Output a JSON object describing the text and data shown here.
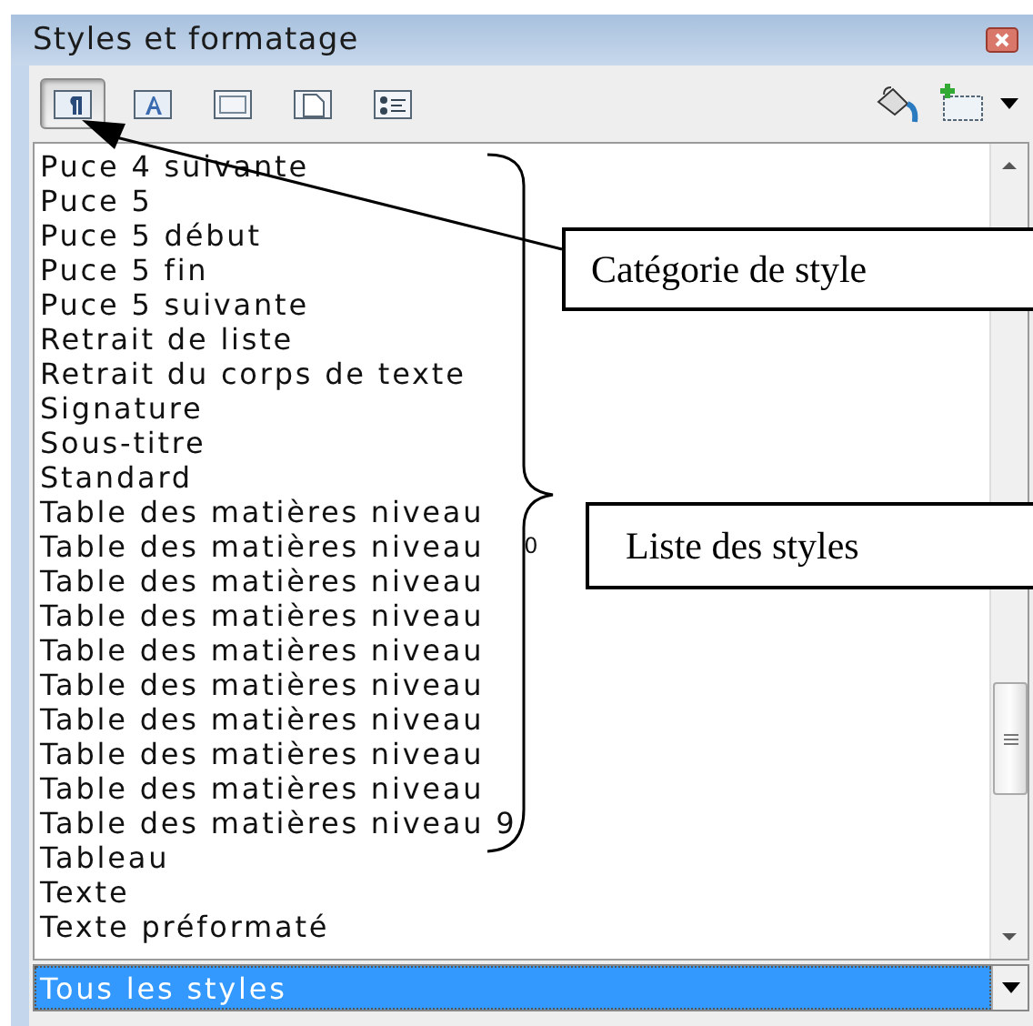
{
  "window": {
    "title": "Styles et formatage"
  },
  "categories": [
    {
      "kind": "paragraph",
      "selected": true
    },
    {
      "kind": "character",
      "selected": false
    },
    {
      "kind": "frame",
      "selected": false
    },
    {
      "kind": "page",
      "selected": false
    },
    {
      "kind": "list",
      "selected": false
    }
  ],
  "styles": [
    {
      "label": "Puce 4 suivante"
    },
    {
      "label": "Puce 5"
    },
    {
      "label": "Puce 5 début"
    },
    {
      "label": "Puce 5 fin"
    },
    {
      "label": "Puce 5 suivante"
    },
    {
      "label": "Retrait de liste"
    },
    {
      "label": "Retrait du corps de texte"
    },
    {
      "label": "Signature"
    },
    {
      "label": "Sous-titre"
    },
    {
      "label": "Standard"
    },
    {
      "label": "Table des matières niveau"
    },
    {
      "label": "Table des matières niveau",
      "suffix": "0"
    },
    {
      "label": "Table des matières niveau"
    },
    {
      "label": "Table des matières niveau"
    },
    {
      "label": "Table des matières niveau"
    },
    {
      "label": "Table des matières niveau"
    },
    {
      "label": "Table des matières niveau"
    },
    {
      "label": "Table des matières niveau"
    },
    {
      "label": "Table des matières niveau"
    },
    {
      "label": "Table des matières niveau 9"
    },
    {
      "label": "Tableau"
    },
    {
      "label": "Texte"
    },
    {
      "label": "Texte préformaté"
    }
  ],
  "filter": {
    "value": "Tous les styles",
    "highlighted": true
  },
  "callouts": [
    {
      "text": "Catégorie de style"
    },
    {
      "text": "Liste des styles"
    }
  ]
}
